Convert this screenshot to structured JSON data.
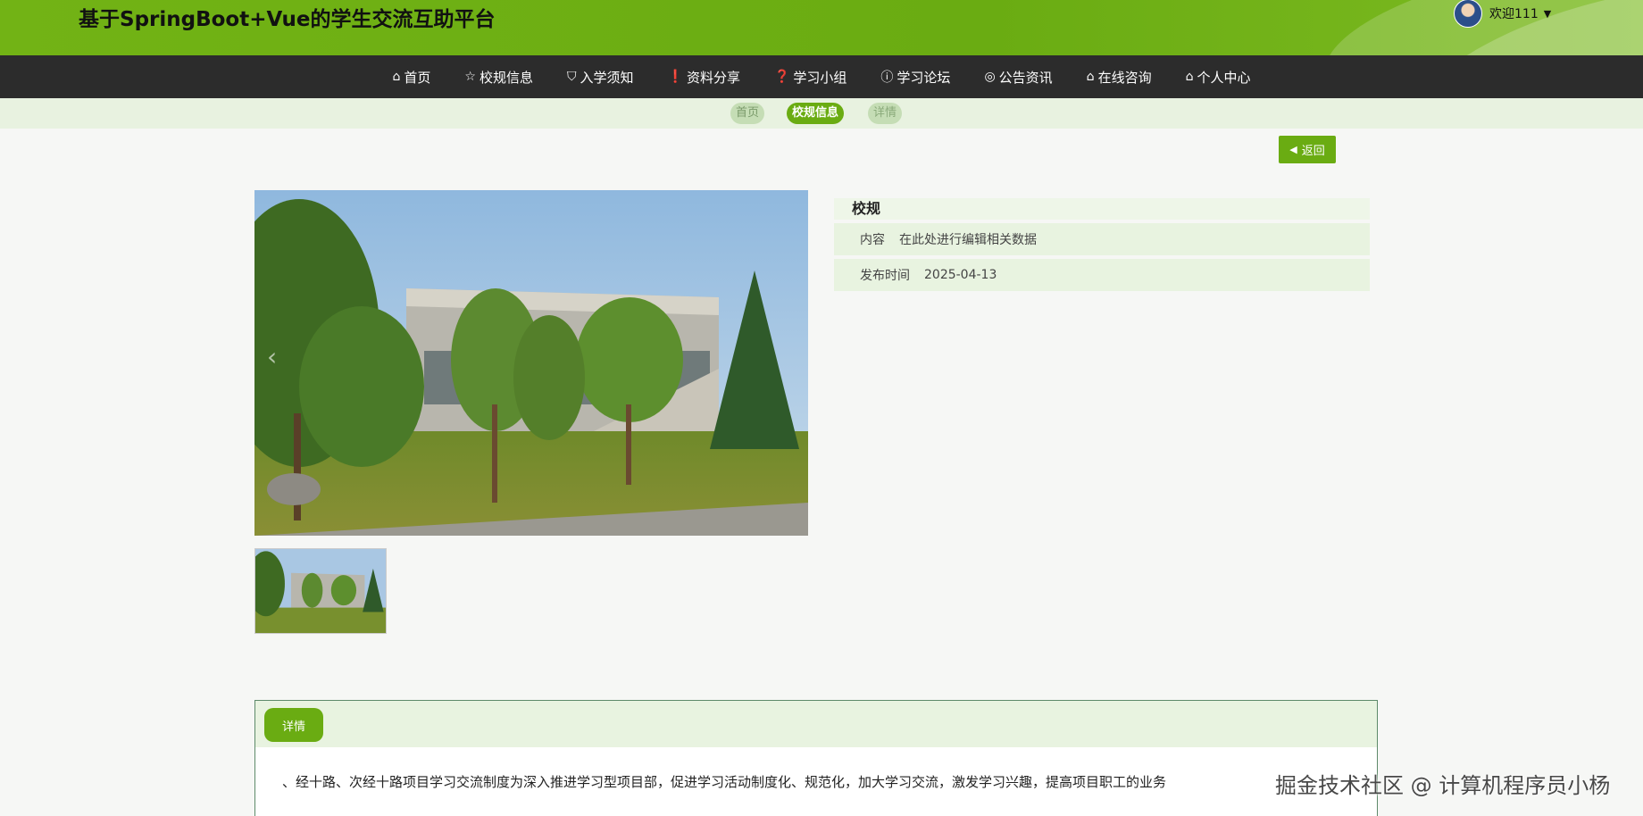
{
  "header": {
    "site_title": "基于SpringBoot+Vue的学生交流互助平台",
    "welcome": "欢迎111"
  },
  "nav": {
    "items": [
      {
        "label": "首页",
        "icon": "home-icon"
      },
      {
        "label": "校规信息",
        "icon": "star-icon"
      },
      {
        "label": "入学须知",
        "icon": "bag-icon"
      },
      {
        "label": "资料分享",
        "icon": "info-icon"
      },
      {
        "label": "学习小组",
        "icon": "question-icon"
      },
      {
        "label": "学习论坛",
        "icon": "info-icon"
      },
      {
        "label": "公告资讯",
        "icon": "target-icon"
      },
      {
        "label": "在线咨询",
        "icon": "home-icon"
      },
      {
        "label": "个人中心",
        "icon": "home-icon"
      }
    ]
  },
  "breadcrumb": {
    "home": "首页",
    "current": "校规信息",
    "detail": "详情"
  },
  "back_button": "返回",
  "info": {
    "title": "校规",
    "content_label": "内容",
    "content_value": "在此处进行编辑相关数据",
    "date_label": "发布时间",
    "date_value": "2025-04-13"
  },
  "detail": {
    "tab_label": "详情",
    "text": "、经十路、次经十路项目学习交流制度为深入推进学习型项目部，促进学习活动制度化、规范化，加大学习交流，激发学习兴趣，提高项目职工的业务"
  },
  "watermark": "掘金技术社区 @ 计算机程序员小杨",
  "colors": {
    "brand_green": "#6aac12",
    "nav_dark": "#2c2c2c"
  }
}
